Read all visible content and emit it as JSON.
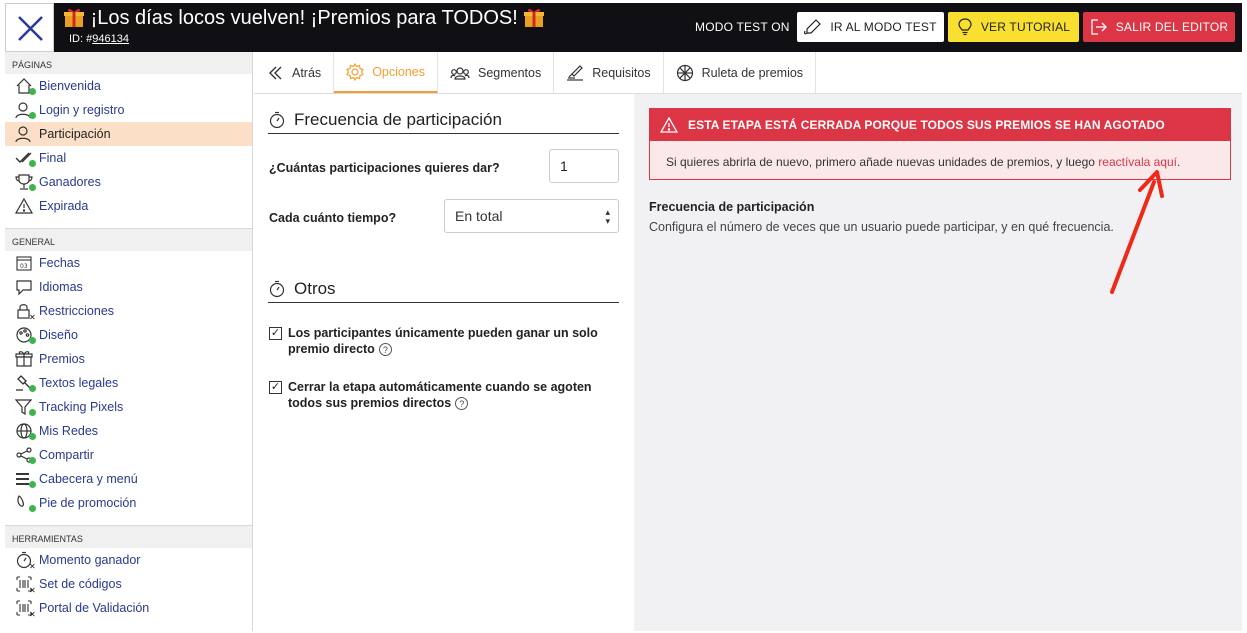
{
  "header": {
    "title": "¡Los días locos vuelven! ¡Premios para TODOS!",
    "id_label": "ID: #",
    "id_value": "946134",
    "mode_label": "MODO TEST ON",
    "btn_test": "IR AL MODO TEST",
    "btn_tutorial": "VER TUTORIAL",
    "btn_exit": "SALIR DEL EDITOR"
  },
  "sidebar": {
    "pages_label": "PÁGINAS",
    "pages": [
      {
        "label": "Bienvenida",
        "icon": "home-icon",
        "status": "dot"
      },
      {
        "label": "Login y registro",
        "icon": "user-icon",
        "status": "dot"
      },
      {
        "label": "Participación",
        "icon": "user-icon",
        "status": "none",
        "active": true
      },
      {
        "label": "Final",
        "icon": "check-icon",
        "status": "dot"
      },
      {
        "label": "Ganadores",
        "icon": "trophy-icon",
        "status": "dot"
      },
      {
        "label": "Expirada",
        "icon": "warning-icon",
        "status": "none"
      }
    ],
    "general_label": "GENERAL",
    "general": [
      {
        "label": "Fechas",
        "icon": "calendar-icon"
      },
      {
        "label": "Idiomas",
        "icon": "speech-bubble-icon"
      },
      {
        "label": "Restricciones",
        "icon": "lock-icon"
      },
      {
        "label": "Diseño",
        "icon": "palette-icon"
      },
      {
        "label": "Premios",
        "icon": "gift-icon"
      },
      {
        "label": "Textos legales",
        "icon": "gavel-icon"
      },
      {
        "label": "Tracking Pixels",
        "icon": "filter-icon"
      },
      {
        "label": "Mis Redes",
        "icon": "globe-icon"
      },
      {
        "label": "Compartir",
        "icon": "share-icon"
      },
      {
        "label": "Cabecera y menú",
        "icon": "menu-icon"
      },
      {
        "label": "Pie de promoción",
        "icon": "footer-icon"
      }
    ],
    "tools_label": "HERRAMIENTAS",
    "tools": [
      {
        "label": "Momento ganador",
        "icon": "stopwatch-icon"
      },
      {
        "label": "Set de códigos",
        "icon": "barcode-icon"
      },
      {
        "label": "Portal de Validación",
        "icon": "barcode-icon"
      }
    ]
  },
  "tabs": [
    {
      "label": "Atrás",
      "icon": "chevron-left-icon"
    },
    {
      "label": "Opciones",
      "icon": "gear-icon",
      "active": true
    },
    {
      "label": "Segmentos",
      "icon": "users-icon"
    },
    {
      "label": "Requisitos",
      "icon": "stamp-icon"
    },
    {
      "label": "Ruleta de premios",
      "icon": "wheel-icon"
    }
  ],
  "form": {
    "section1_title": "Frecuencia de participación",
    "q1_label": "¿Cuántas participaciones quieres dar?",
    "q1_value": "1",
    "q2_label": "Cada cuánto tiempo?",
    "q2_value": "En total",
    "section2_title": "Otros",
    "check1_label": "Los participantes únicamente pueden ganar un solo premio directo",
    "check1_checked": true,
    "check2_label": "Cerrar la etapa automáticamente cuando se agoten todos sus premios directos",
    "check2_checked": true
  },
  "alert": {
    "title": "ESTA ETAPA ESTÁ CERRADA PORQUE TODOS SUS PREMIOS SE HAN AGOTADO",
    "body": "Si quieres abrirla de nuevo, primero añade nuevas unidades de premios, y luego",
    "link": "reactívala aquí",
    "end": "."
  },
  "info": {
    "title": "Frecuencia de participación",
    "desc": "Configura el número de veces que un usuario puede participar, y en qué frecuencia."
  },
  "colors": {
    "accent": "#f0a030",
    "danger": "#dc3545",
    "link": "#2a3a8c",
    "status_dot": "#3cb54a",
    "tutorial": "#f9e030"
  }
}
